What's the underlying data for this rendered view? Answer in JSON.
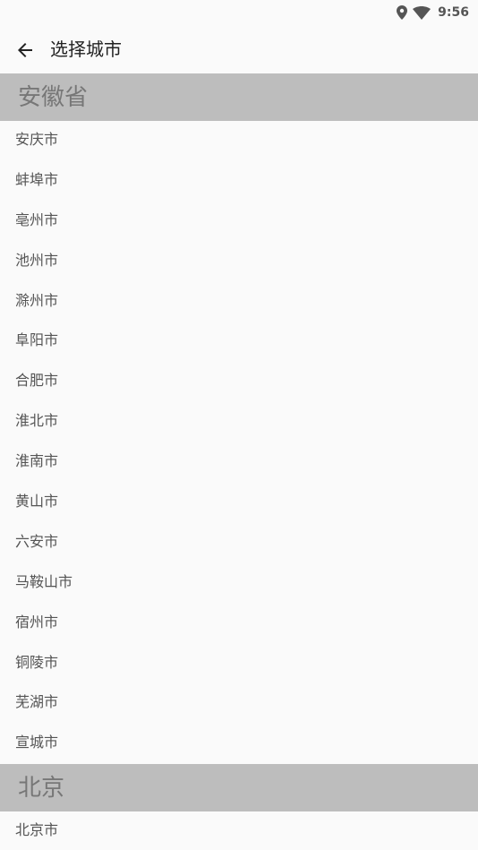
{
  "status_bar": {
    "time": "9:56",
    "icons": [
      "location-icon",
      "wifi-icon"
    ]
  },
  "app_bar": {
    "back_icon": "arrow-back-icon",
    "title": "选择城市"
  },
  "sections": [
    {
      "header": "安徽省",
      "cities": [
        "安庆市",
        "蚌埠市",
        "亳州市",
        "池州市",
        "滁州市",
        "阜阳市",
        "合肥市",
        "淮北市",
        "淮南市",
        "黄山市",
        "六安市",
        "马鞍山市",
        "宿州市",
        "铜陵市",
        "芜湖市",
        "宣城市"
      ]
    },
    {
      "header": "北京",
      "cities": [
        "北京市"
      ]
    }
  ],
  "colors": {
    "background": "#fafafa",
    "section_header_bg": "#bdbdbd",
    "section_header_text": "#777777",
    "city_text": "#555555"
  }
}
